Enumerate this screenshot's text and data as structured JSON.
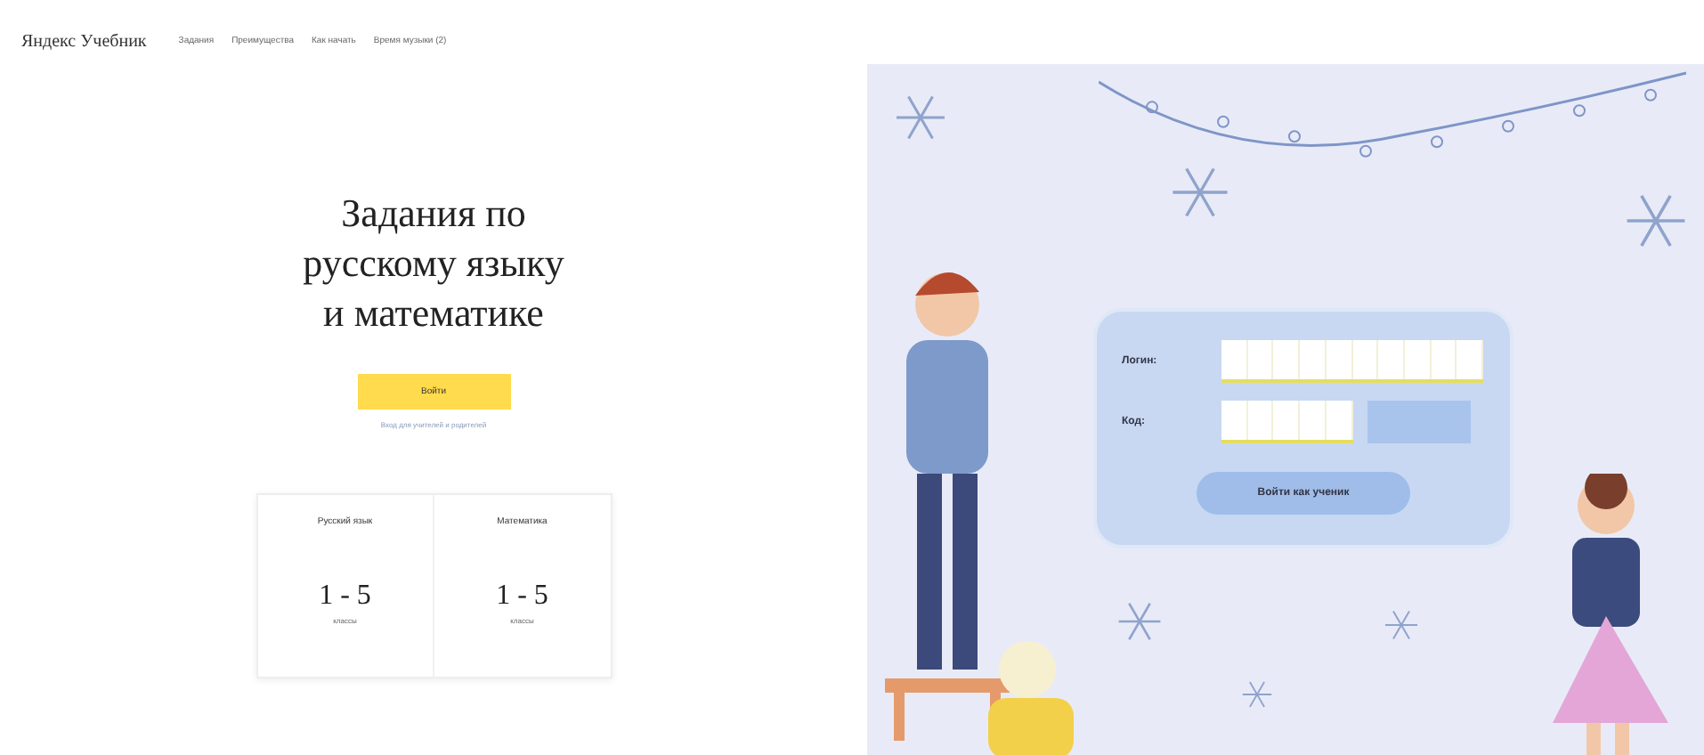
{
  "header": {
    "logo": "Яндекс Учебник",
    "nav": [
      "Задания",
      "Преимущества",
      "Как начать",
      "Время музыки (2)"
    ]
  },
  "hero": {
    "title": "Задания по русскому языку и математике",
    "button": "Войти",
    "link": "Вход для учителей и родителей"
  },
  "subjects": [
    {
      "name": "Русский язык",
      "grades": "1 - 5",
      "unit": "классы"
    },
    {
      "name": "Математика",
      "grades": "1 - 5",
      "unit": "классы"
    }
  ],
  "login": {
    "fields": [
      {
        "label": "Логин:",
        "kind": "long"
      },
      {
        "label": "Код:",
        "kind": "short"
      }
    ],
    "button": "Войти как ученик"
  }
}
